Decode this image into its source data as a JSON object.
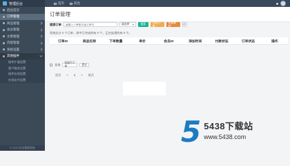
{
  "header": {
    "brand": "管理后台",
    "links": [
      "首页",
      "前台"
    ]
  },
  "sidebar": {
    "items": [
      {
        "label": "后台首页",
        "state": "normal"
      },
      {
        "label": "订单管理",
        "state": "active"
      },
      {
        "label": "商品管理",
        "state": "normal"
      },
      {
        "label": "会员管理",
        "state": "normal"
      },
      {
        "label": "文章管理",
        "state": "normal"
      },
      {
        "label": "内容管理",
        "state": "normal"
      },
      {
        "label": "系统设置",
        "state": "normal"
      },
      {
        "label": "其他插件",
        "state": "open"
      }
    ],
    "sub_items": [
      "插件扩展设置",
      "客户服务设置",
      "插件在线设置",
      "在线支付设置"
    ],
    "footer": "© 2019 后台管理系统"
  },
  "page": {
    "title": "订单管理"
  },
  "toolbar": {
    "label": "搜索订单",
    "search_placeholder": "请输入下单账号或订单号",
    "select_value": "请选择",
    "search_button": "搜索",
    "button_2": "导出订单",
    "button_3": "批量删除",
    "refresh": "⟳"
  },
  "summary": "系统总计 0 个订单，其中已完成的有 0 个，正在处理的有 0 个。",
  "table": {
    "columns": [
      "订单ID",
      "商品名称",
      "下单数量",
      "单价",
      "会员ID",
      "添加时间",
      "付款状态",
      "订单状态",
      "操作"
    ]
  },
  "bulk": {
    "label": "全选",
    "select_value": "批量打订单",
    "button": "提交"
  },
  "pager": {
    "prev": "首页",
    "p1": "<",
    "current": "1",
    "next": ">",
    "last": "尾页"
  },
  "watermark": {
    "digit": "5",
    "title": "5438下载站",
    "url": "www.5438.com"
  },
  "colors": {
    "sidebar": "#3c4a58",
    "active": "#5a6b7c",
    "search": "#1ab394",
    "export": "#f0ad4e",
    "delete": "#e8883c",
    "watermark": "#1d7cc0"
  }
}
